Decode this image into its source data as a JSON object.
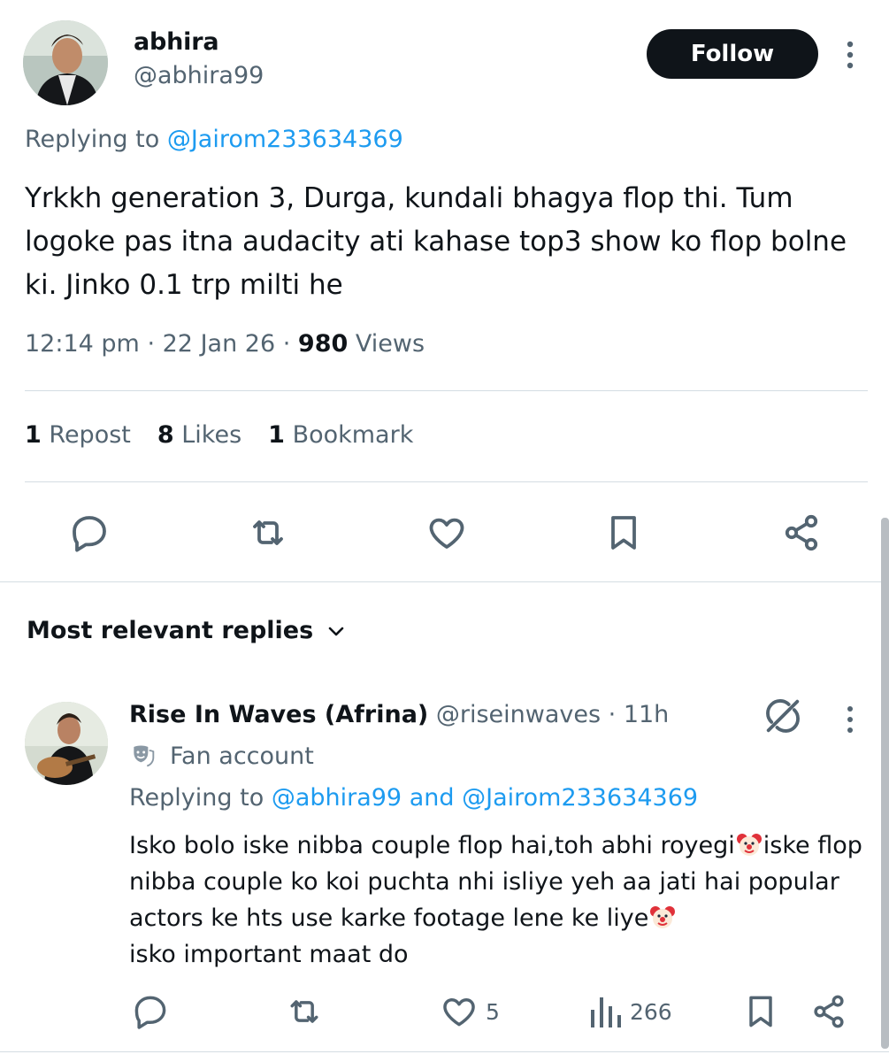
{
  "tweet": {
    "author_name": "abhira",
    "author_handle": "@abhira99",
    "follow_label": "Follow",
    "replying_prefix": "Replying to",
    "replying_to": "@Jairom233634369",
    "text": "Yrkkh generation 3, Durga, kundali bhagya flop thi. Tum logoke pas itna audacity ati kahase top3 show ko flop bolne ki. Jinko 0.1 trp milti he",
    "time": "12:14 pm",
    "date": "22 Jan 26",
    "views_count": "980",
    "views_label": "Views",
    "separator": "·",
    "stats": {
      "reposts_count": "1",
      "reposts_label": "Repost",
      "likes_count": "8",
      "likes_label": "Likes",
      "bookmarks_count": "1",
      "bookmarks_label": "Bookmark"
    },
    "actions": [
      "reply-icon",
      "repost-icon",
      "like-icon",
      "bookmark-icon",
      "share-icon"
    ]
  },
  "replies_sort": {
    "label": "Most relevant replies"
  },
  "reply": {
    "author_name": "Rise In Waves (Afrina)",
    "author_handle": "@riseinwaves",
    "separator": "·",
    "time": "11h",
    "badge_label": "Fan account",
    "replying_prefix": "Replying to",
    "replying_to_1": "@abhira99",
    "replying_and": "and",
    "replying_to_2": "@Jairom233634369",
    "text_part1": "Isko bolo iske nibba couple flop hai,toh abhi royegi",
    "text_part2": "iske flop nibba couple ko koi puchta nhi isliye yeh aa jati hai popular actors ke hts use karke footage lene ke liye",
    "text_part3": "isko important maat do",
    "emoji": "clown-face",
    "likes_count": "5",
    "views_count": "266"
  },
  "colors": {
    "accent": "#1d9bf0",
    "text": "#0f1419",
    "muted": "#536471",
    "divider": "#d4dde3"
  }
}
